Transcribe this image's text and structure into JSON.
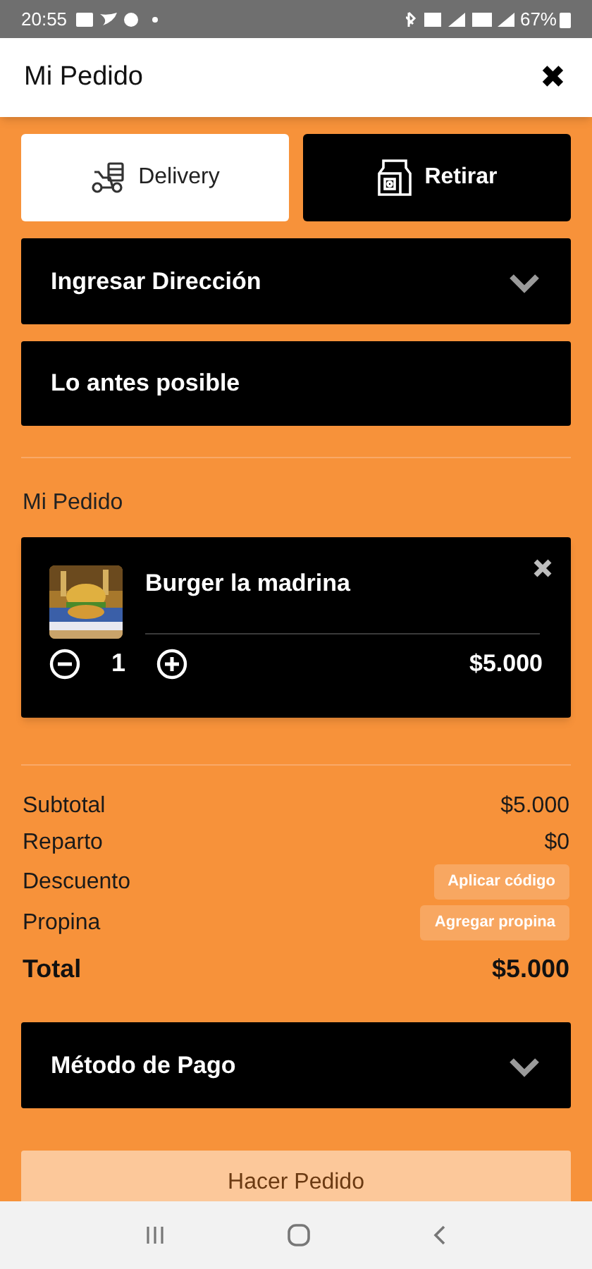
{
  "status_bar": {
    "time": "20:55",
    "battery": "67%"
  },
  "header": {
    "title": "Mi Pedido",
    "close": "✖"
  },
  "tabs": [
    {
      "label": "Delivery",
      "kind": "delivery",
      "selected": true
    },
    {
      "label": "Retirar",
      "kind": "pickup",
      "selected": false
    }
  ],
  "address": {
    "label": "Ingresar Dirección",
    "expanded": false
  },
  "schedule": {
    "label": "Lo antes posible"
  },
  "order": {
    "heading": "Mi Pedido",
    "items": [
      {
        "name": "Burger la madrina",
        "quantity": "1",
        "price": "$5.000"
      }
    ]
  },
  "summary": [
    {
      "label": "Subtotal",
      "kind": "value",
      "value": "$5.000"
    },
    {
      "label": "Reparto",
      "kind": "value",
      "value": "$0"
    },
    {
      "label": "Descuento",
      "kind": "action",
      "value": "Aplicar código"
    },
    {
      "label": "Propina",
      "kind": "action",
      "value": "Agregar propina"
    },
    {
      "label": "Total",
      "kind": "total",
      "value": "$5.000"
    }
  ],
  "payment": {
    "label": "Método de Pago",
    "expanded": false
  },
  "submit": {
    "label": "Hacer Pedido",
    "disabled": true
  }
}
